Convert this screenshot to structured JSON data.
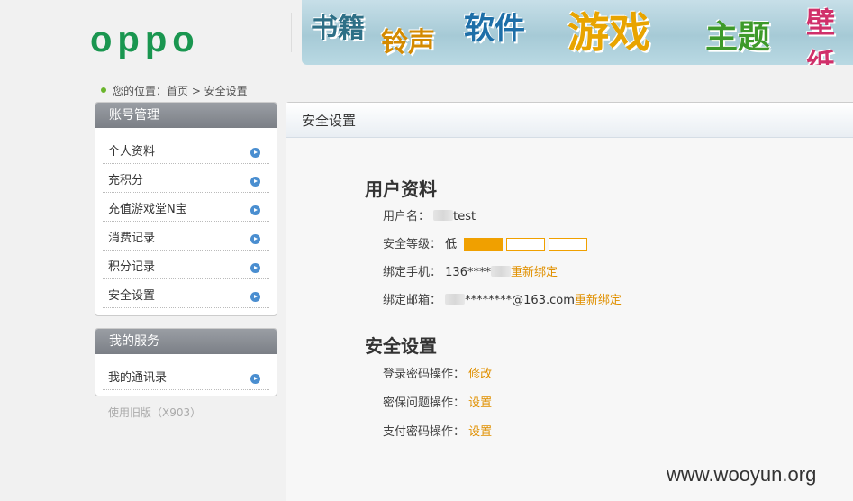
{
  "header": {
    "logo": "oppo",
    "banner_categories": [
      "书籍",
      "铃声",
      "软件",
      "游戏",
      "主题",
      "壁纸"
    ]
  },
  "breadcrumb": "您的位置：首页 > 安全设置",
  "sidebar": {
    "account": {
      "title": "账号管理",
      "items": [
        {
          "label": "个人资料"
        },
        {
          "label": "充积分"
        },
        {
          "label": "充值游戏堂N宝"
        },
        {
          "label": "消费记录"
        },
        {
          "label": "积分记录"
        },
        {
          "label": "安全设置"
        }
      ]
    },
    "services": {
      "title": "我的服务",
      "items": [
        {
          "label": "我的通讯录"
        }
      ]
    },
    "old_version": "使用旧版（X903）"
  },
  "main": {
    "title": "安全设置",
    "profile": {
      "title": "用户资料",
      "username_label": "用户名：",
      "username_value": "test",
      "security_label": "安全等级：",
      "security_value": "低",
      "security_level": 1,
      "security_max": 3,
      "phone_label": "绑定手机：",
      "phone_value": "136****",
      "phone_action": "重新绑定",
      "email_label": "绑定邮箱：",
      "email_value": "********@163.com",
      "email_action": "重新绑定"
    },
    "security": {
      "title": "安全设置",
      "login_label": "登录密码操作：",
      "login_action": "修改",
      "question_label": "密保问题操作：",
      "question_action": "设置",
      "pay_label": "支付密码操作：",
      "pay_action": "设置"
    }
  },
  "watermark": "www.wooyun.org",
  "colors": {
    "brand": "#1a9650",
    "link": "#e09000",
    "level_bar": "#f0a000",
    "sidebar_header": "#7b7f86"
  }
}
